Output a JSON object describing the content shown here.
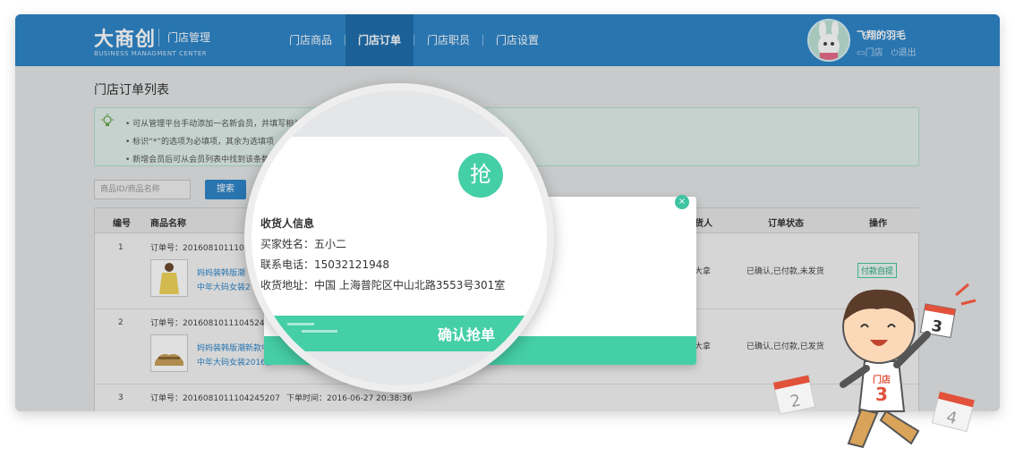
{
  "header": {
    "logo_text": "大商创",
    "logo_sub": "BUSINESS MANAGMENT CENTER",
    "section": "门店管理",
    "nav": [
      "门店商品",
      "门店订单",
      "门店职员",
      "门店设置"
    ],
    "active_nav_index": 1,
    "user_name": "飞翔的羽毛",
    "store_link": "门店",
    "logout_link": "退出"
  },
  "page": {
    "title": "门店订单列表",
    "tips": [
      "可从管理平台手动添加一名新会员，并填写相关",
      "标识“*”的选项为必填项，其余为选填项",
      "新增会员后可从会员列表中找到该条数"
    ],
    "search_placeholder": "商品ID/商品名称",
    "search_button": "搜索"
  },
  "table": {
    "headers": {
      "no": "编号",
      "name": "商品名称",
      "receiver": "货人",
      "status": "订单状态",
      "action": "操作"
    },
    "rows": [
      {
        "no": "1",
        "order": "订单号：2016081011104520",
        "product_line1": "妈妈装韩版潮",
        "product_line2": "中年大码女装2",
        "receiver": "大拿",
        "status": "已确认,已付款,未发货",
        "action": "付款自提"
      },
      {
        "no": "2",
        "order": "订单号：2016081011104524520",
        "product_line1": "妈妈装韩版潮新款中年大码",
        "product_line2": "中年大码女装2016胖MM",
        "receiver": "大拿",
        "status": "已确认,已付款,已发货",
        "action": ""
      },
      {
        "no": "3",
        "order": "订单号：2016081011104245207",
        "time": "下单时间：2016-06-27 20:38:36"
      }
    ]
  },
  "modal": {
    "close_symbol": "×",
    "footer_button": "认抢单",
    "grab_symbol": "抢",
    "receiver_title": "收货人信息",
    "buyer_name": "买家姓名：五小二",
    "phone": "联系电话：15032121948",
    "address": "收货地址：中国 上海普陀区中山北路3553号301室",
    "confirm_button": "确认抢单"
  },
  "mascot": {
    "shirt_text_1": "门店",
    "shirt_number": "3",
    "calendar_numbers": [
      "3",
      "2",
      "4"
    ]
  },
  "colors": {
    "header_blue": "#2f86c9",
    "accent_green": "#45cfa6"
  }
}
